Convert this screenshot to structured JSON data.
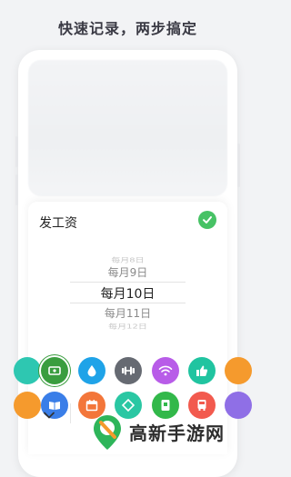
{
  "headline": "快速记录，两步搞定",
  "sheet": {
    "title": "发工资",
    "picker": {
      "items": [
        "每月8日",
        "每月9日",
        "每月10日",
        "每月11日",
        "每月12日"
      ],
      "selected_index": 2
    }
  },
  "icons_row1": [
    {
      "name": "edge-left-icon",
      "color": "#2ec7b1"
    },
    {
      "name": "ticket-icon",
      "color": "#3a9d3f"
    },
    {
      "name": "water-drop-icon",
      "color": "#1fa3e8"
    },
    {
      "name": "dumbbell-icon",
      "color": "#666a72"
    },
    {
      "name": "wifi-icon",
      "color": "#b85ce8"
    },
    {
      "name": "thumbs-up-icon",
      "color": "#20c4a0"
    },
    {
      "name": "edge-right-icon",
      "color": "#f59a2d"
    }
  ],
  "icons_row2": [
    {
      "name": "edge-left-icon",
      "color": "#f59a2d"
    },
    {
      "name": "book-icon",
      "color": "#3a7ee8"
    },
    {
      "name": "calendar-icon",
      "color": "#f3763a"
    },
    {
      "name": "diamond-icon",
      "color": "#2ac7a3"
    },
    {
      "name": "phone-card-icon",
      "color": "#32b84a"
    },
    {
      "name": "bus-icon",
      "color": "#f25a4e"
    },
    {
      "name": "edge-right-icon",
      "color": "#8f6fe6"
    }
  ],
  "watermark": "高新手游网",
  "colors": {
    "accent": "#47c265",
    "background": "#f2f3f5"
  }
}
